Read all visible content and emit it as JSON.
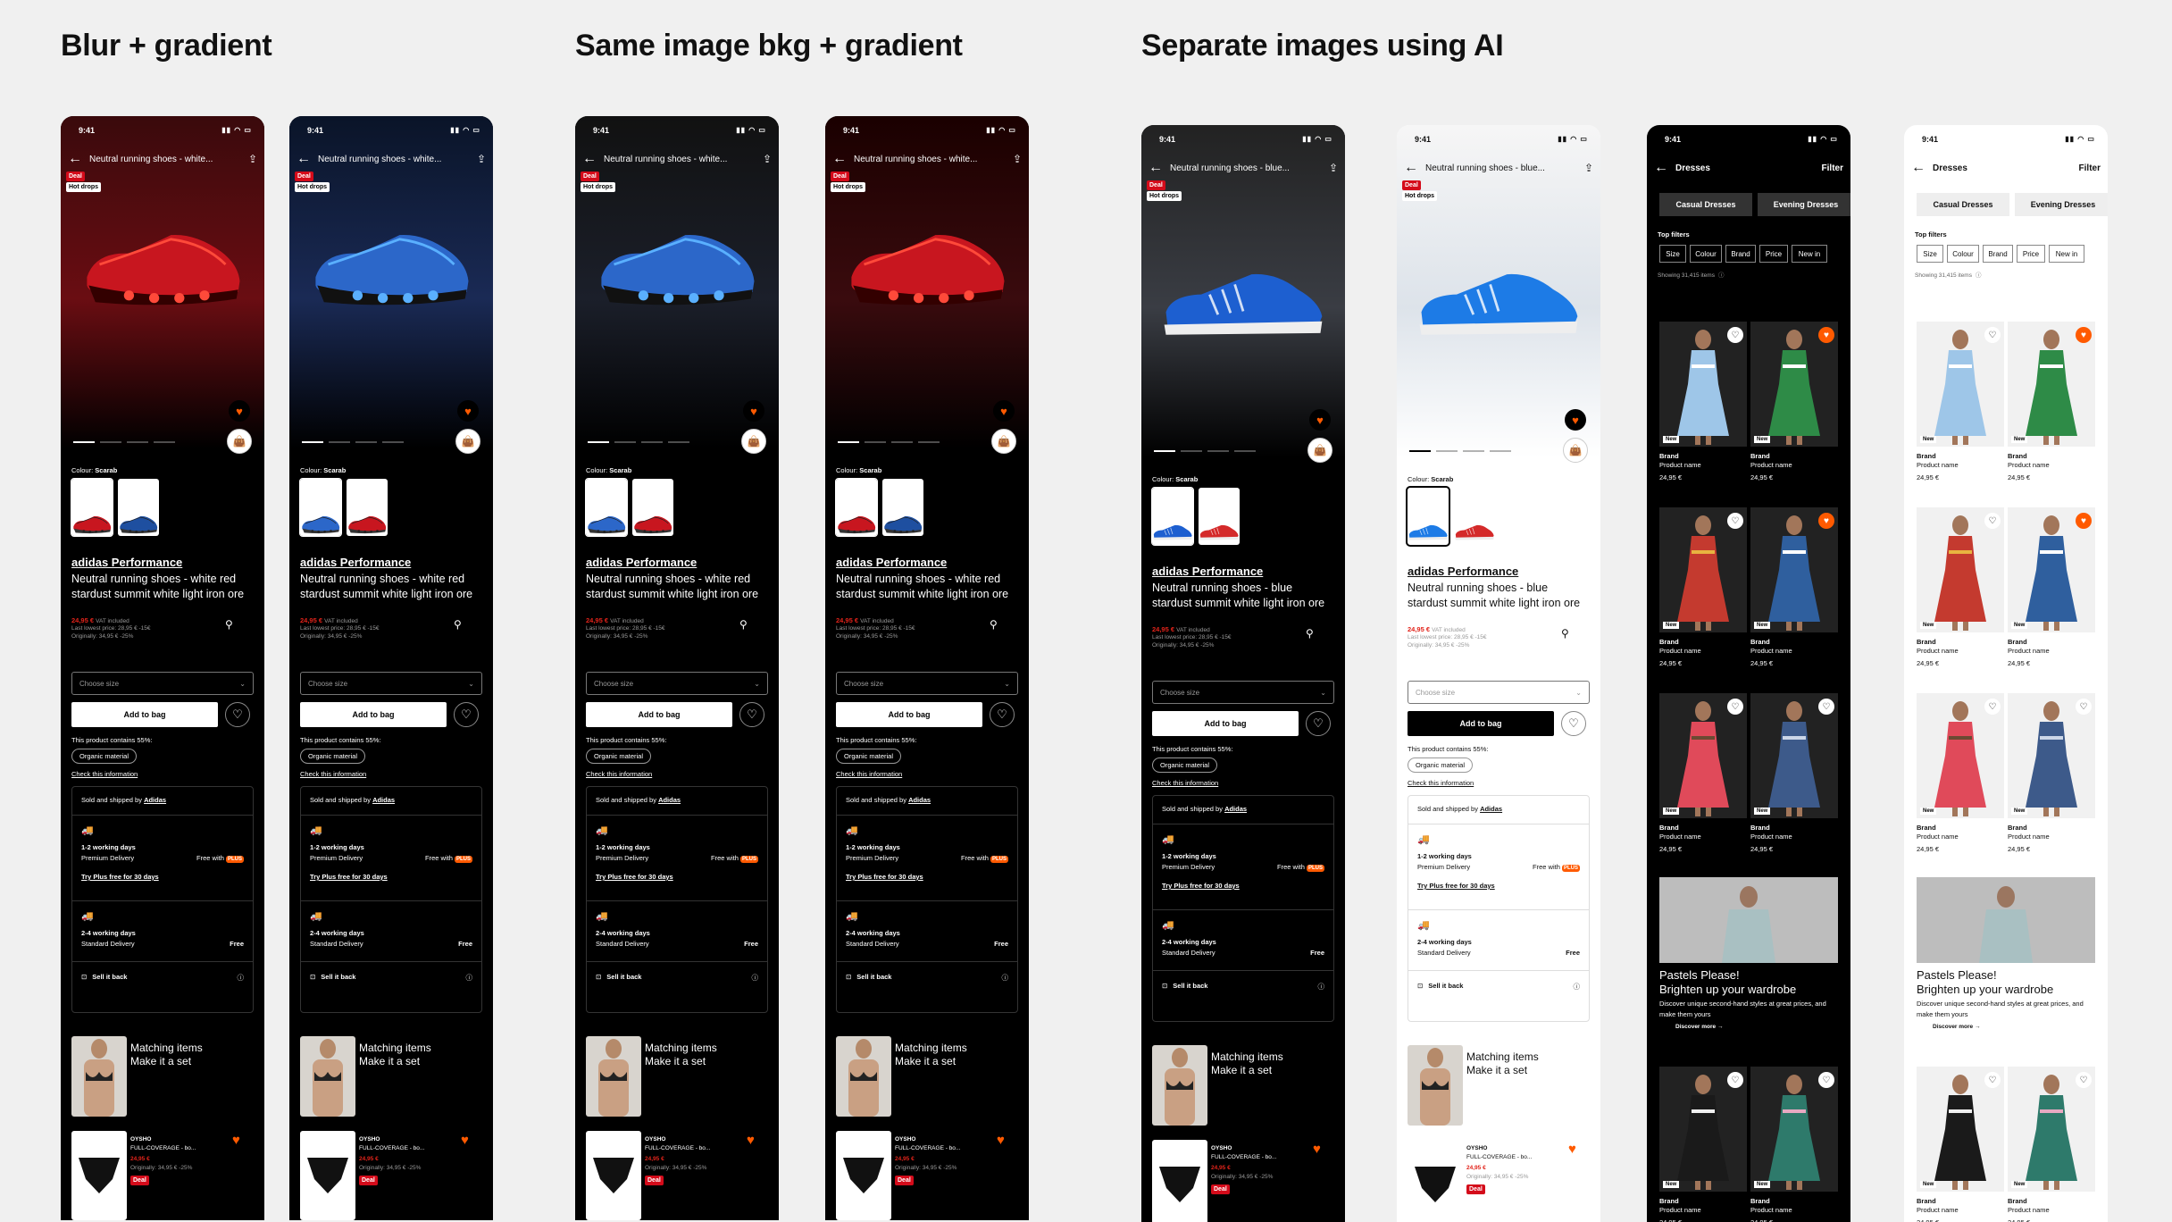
{
  "sections": [
    {
      "title": "Blur + gradient"
    },
    {
      "title": "Same image bkg + gradient"
    },
    {
      "title": "Separate images using AI"
    }
  ],
  "pdp": {
    "time": "9:41",
    "title": "Neutral running shoes - white...",
    "title_blue": "Neutral running shoes - blue...",
    "badge_deal": "Deal",
    "badge_hot": "Hot drops",
    "colour_label": "Colour:",
    "colour_value": "Scarab",
    "brand": "adidas Performance",
    "name": "Neutral running shoes - white red stardust summit white light iron ore",
    "name_blue": "Neutral running shoes - blue stardust summit white light iron ore",
    "price": "24,95 €",
    "vat": "VAT included",
    "lowest": "Last lowest price: 28,95 € -15€",
    "originally": "Originally: 34,95 € -25%",
    "choose_size": "Choose size",
    "add_to_bag": "Add to bag",
    "contains": "This product contains 55%:",
    "organic": "Organic material",
    "check_info": "Check this information",
    "sold_by_prefix": "Sold and shipped by",
    "sold_by": "Adidas",
    "premium_days": "1-2 working days",
    "premium_label": "Premium Delivery",
    "free_with": "Free with",
    "plus": "PLUS",
    "try_plus": "Try Plus free for 30 days",
    "standard_days": "2-4 working days",
    "standard_label": "Standard Delivery",
    "free": "Free",
    "sell_back": "Sell it back",
    "matching": "Matching items",
    "make_set": "Make it a set",
    "rec_brand": "OYSHO",
    "rec_name": "FULL-COVERAGE - bo...",
    "rec_price": "24,95 €",
    "rec_orig": "Originally: 34,95 € -25%",
    "rec_deal": "Deal"
  },
  "catalog": {
    "time": "9:41",
    "title": "Dresses",
    "filter": "Filter",
    "tabs": [
      "Casual Dresses",
      "Evening Dresses"
    ],
    "top_filters": "Top filters",
    "chips": [
      "Size",
      "Colour",
      "Brand",
      "Price",
      "New in"
    ],
    "showing": "Showing 31,415 items",
    "new_badge": "New",
    "brand": "Brand",
    "product_name": "Product name",
    "price": "24,95 €",
    "promo_title": "Pastels Please!",
    "promo_sub": "Brighten up your wardrobe",
    "promo_desc": "Discover unique second-hand styles at great prices, and make them yours",
    "promo_cta": "Discover more"
  },
  "colors": {
    "accent": "#ff5a00",
    "deal": "#d40b1a",
    "price_red": "#e2231a"
  }
}
